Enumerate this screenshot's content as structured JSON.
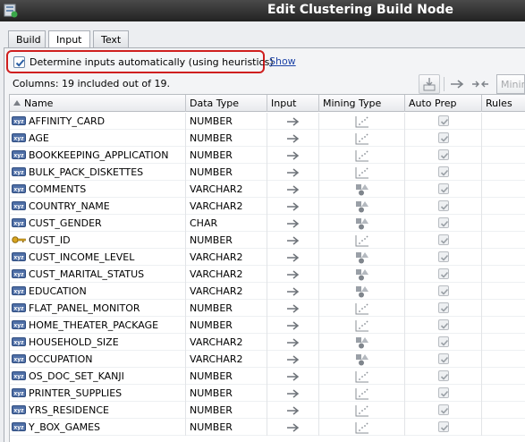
{
  "window": {
    "title": "Edit Clustering Build Node"
  },
  "tabs": [
    {
      "label": "Build"
    },
    {
      "label": "Input"
    },
    {
      "label": "Text"
    }
  ],
  "heuristics": {
    "label": "Determine inputs automatically (using heuristics)",
    "checked": true,
    "show_link": "Show"
  },
  "columns_summary": "Columns: 19 included out of 19.",
  "toolbar": {
    "mining_select_text": "Minin"
  },
  "table": {
    "headers": {
      "name": "Name",
      "data_type": "Data Type",
      "input": "Input",
      "mining_type": "Mining Type",
      "auto_prep": "Auto Prep",
      "rules": "Rules"
    },
    "rows": [
      {
        "name": "AFFINITY_CARD",
        "data_type": "NUMBER",
        "icon": "text-type-icon",
        "mining_type": "numerical"
      },
      {
        "name": "AGE",
        "data_type": "NUMBER",
        "icon": "text-type-icon",
        "mining_type": "numerical"
      },
      {
        "name": "BOOKKEEPING_APPLICATION",
        "data_type": "NUMBER",
        "icon": "text-type-icon",
        "mining_type": "numerical"
      },
      {
        "name": "BULK_PACK_DISKETTES",
        "data_type": "NUMBER",
        "icon": "text-type-icon",
        "mining_type": "numerical"
      },
      {
        "name": "COMMENTS",
        "data_type": "VARCHAR2",
        "icon": "text-type-icon",
        "mining_type": "categorical"
      },
      {
        "name": "COUNTRY_NAME",
        "data_type": "VARCHAR2",
        "icon": "text-type-icon",
        "mining_type": "categorical"
      },
      {
        "name": "CUST_GENDER",
        "data_type": "CHAR",
        "icon": "text-type-icon",
        "mining_type": "categorical"
      },
      {
        "name": "CUST_ID",
        "data_type": "NUMBER",
        "icon": "key-icon",
        "mining_type": "numerical"
      },
      {
        "name": "CUST_INCOME_LEVEL",
        "data_type": "VARCHAR2",
        "icon": "text-type-icon",
        "mining_type": "categorical"
      },
      {
        "name": "CUST_MARITAL_STATUS",
        "data_type": "VARCHAR2",
        "icon": "text-type-icon",
        "mining_type": "categorical"
      },
      {
        "name": "EDUCATION",
        "data_type": "VARCHAR2",
        "icon": "text-type-icon",
        "mining_type": "categorical"
      },
      {
        "name": "FLAT_PANEL_MONITOR",
        "data_type": "NUMBER",
        "icon": "text-type-icon",
        "mining_type": "numerical"
      },
      {
        "name": "HOME_THEATER_PACKAGE",
        "data_type": "NUMBER",
        "icon": "text-type-icon",
        "mining_type": "numerical"
      },
      {
        "name": "HOUSEHOLD_SIZE",
        "data_type": "VARCHAR2",
        "icon": "text-type-icon",
        "mining_type": "categorical"
      },
      {
        "name": "OCCUPATION",
        "data_type": "VARCHAR2",
        "icon": "text-type-icon",
        "mining_type": "categorical"
      },
      {
        "name": "OS_DOC_SET_KANJI",
        "data_type": "NUMBER",
        "icon": "text-type-icon",
        "mining_type": "numerical"
      },
      {
        "name": "PRINTER_SUPPLIES",
        "data_type": "NUMBER",
        "icon": "text-type-icon",
        "mining_type": "numerical"
      },
      {
        "name": "YRS_RESIDENCE",
        "data_type": "NUMBER",
        "icon": "text-type-icon",
        "mining_type": "numerical"
      },
      {
        "name": "Y_BOX_GAMES",
        "data_type": "NUMBER",
        "icon": "text-type-icon",
        "mining_type": "numerical"
      }
    ]
  },
  "colors": {
    "highlight_border": "#cf1f1f",
    "link": "#1f45a8",
    "title_bg": "#2e2e2e"
  }
}
